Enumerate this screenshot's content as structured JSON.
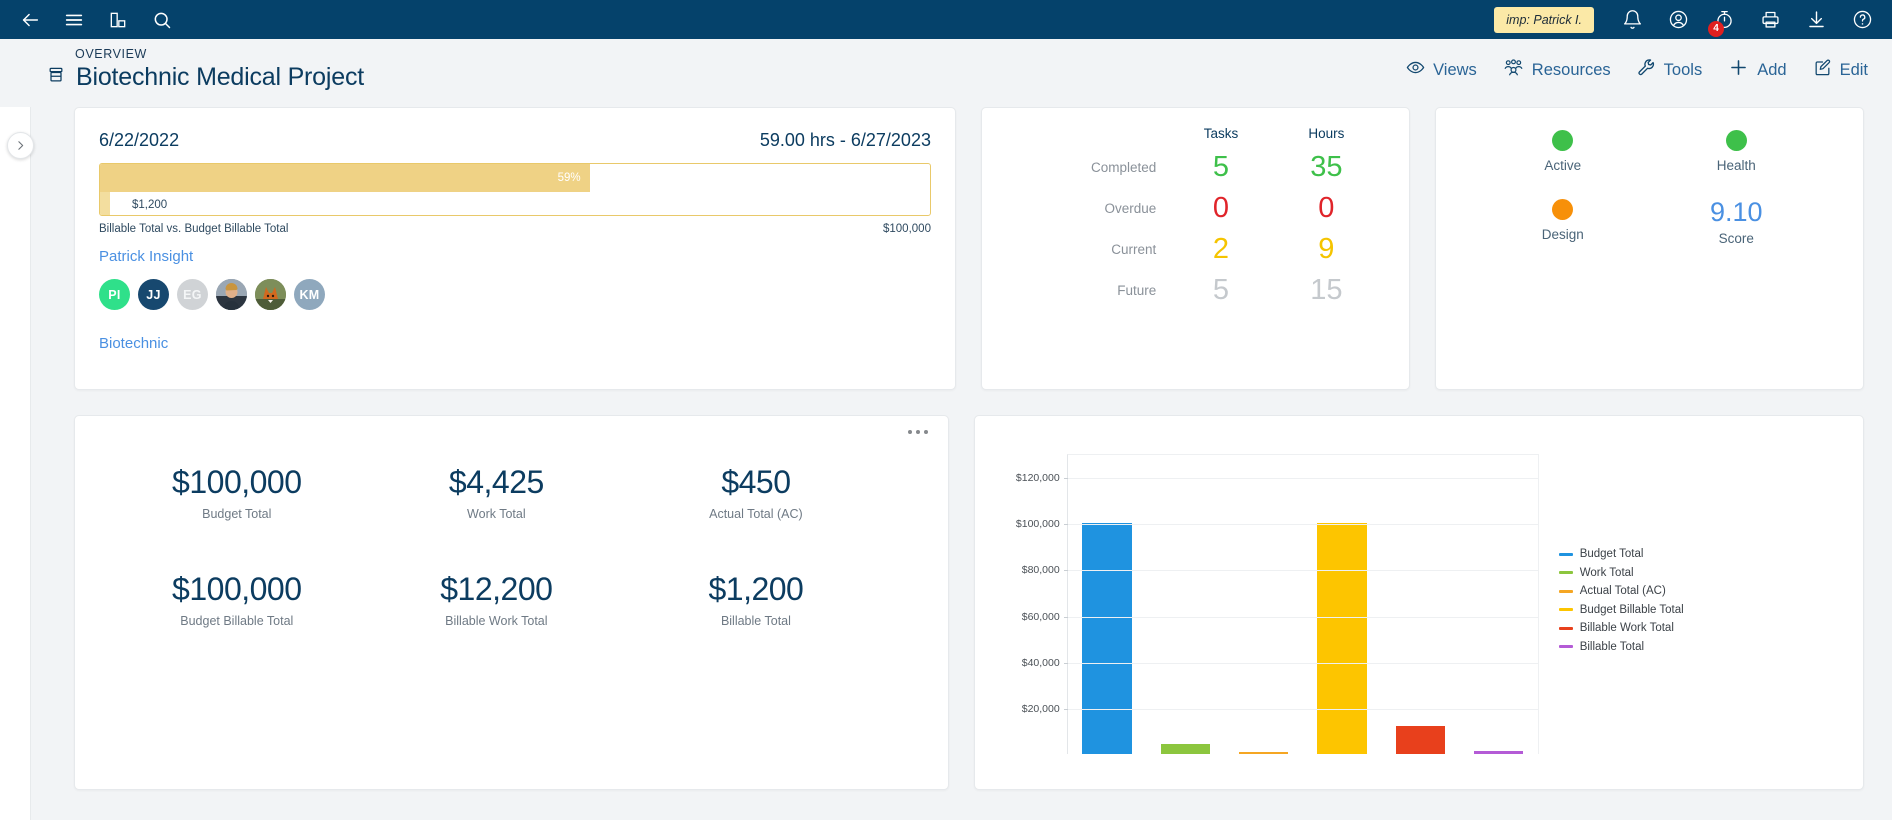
{
  "topnav": {
    "icons": [
      {
        "name": "back-arrow-icon",
        "label": "Back"
      },
      {
        "name": "hamburger-menu-icon",
        "label": "Menu"
      },
      {
        "name": "reports-icon",
        "label": "Reports"
      },
      {
        "name": "search-icon",
        "label": "Search"
      }
    ],
    "impersonation_badge": "imp: Patrick I.",
    "right_icons": [
      {
        "name": "bell-icon",
        "label": "Notifications"
      },
      {
        "name": "user-account-icon",
        "label": "Account"
      },
      {
        "name": "timer-icon",
        "label": "Timers",
        "badge": "4"
      },
      {
        "name": "printer-icon",
        "label": "Print"
      },
      {
        "name": "download-icon",
        "label": "Download"
      },
      {
        "name": "help-icon",
        "label": "Help"
      }
    ]
  },
  "header": {
    "breadcrumb": "OVERVIEW",
    "title": "Biotechnic Medical Project",
    "project_icon": "project-box-icon",
    "actions": [
      {
        "label": "Views",
        "icon": "eye-icon"
      },
      {
        "label": "Resources",
        "icon": "people-group-icon"
      },
      {
        "label": "Tools",
        "icon": "wrench-icon"
      },
      {
        "label": "Add",
        "icon": "plus-icon"
      },
      {
        "label": "Edit",
        "icon": "pencil-square-icon"
      }
    ]
  },
  "sidebar": {
    "expand_toggle_icon": "chevron-right-icon"
  },
  "progress_card": {
    "start_date": "6/22/2022",
    "hours_and_end": "59.00 hrs - 6/27/2023",
    "top_bar_percent_label": "59%",
    "top_bar_percent": 59,
    "bottom_bar_value_label": "$1,200",
    "bottom_bar_percent": 1.2,
    "legend_left": "Billable Total vs. Budget Billable Total",
    "legend_right": "$100,000",
    "insight_link": "Patrick Insight",
    "company_link": "Biotechnic",
    "avatars": [
      {
        "initials": "PI",
        "color": "#2fe08a",
        "type": "initials"
      },
      {
        "initials": "JJ",
        "color": "#17486f",
        "type": "initials"
      },
      {
        "initials": "EG",
        "color": "#d0d3d6",
        "type": "initials"
      },
      {
        "initials": "",
        "color": "#7d8a97",
        "type": "photo-person"
      },
      {
        "initials": "",
        "color": "#6f7f52",
        "type": "photo-fox"
      },
      {
        "initials": "KM",
        "color": "#8fa8bd",
        "type": "initials"
      }
    ]
  },
  "matrix_card": {
    "columns": [
      "Tasks",
      "Hours"
    ],
    "rows": [
      {
        "label": "Completed",
        "tasks": "5",
        "hours": "35",
        "color_class": "g"
      },
      {
        "label": "Overdue",
        "tasks": "0",
        "hours": "0",
        "color_class": "r"
      },
      {
        "label": "Current",
        "tasks": "2",
        "hours": "9",
        "color_class": "y"
      },
      {
        "label": "Future",
        "tasks": "5",
        "hours": "15",
        "color_class": "gr"
      }
    ]
  },
  "status_card": {
    "items": [
      {
        "label": "Active",
        "dot_color": "#3ec04a",
        "kind": "dot"
      },
      {
        "label": "Health",
        "dot_color": "#3ec04a",
        "kind": "dot"
      },
      {
        "label": "Design",
        "dot_color": "#f79009",
        "kind": "dot"
      },
      {
        "label": "Score",
        "value": "9.10",
        "kind": "value"
      }
    ]
  },
  "kpi_card": {
    "menu_icon": "ellipsis-icon",
    "items": [
      {
        "value": "$100,000",
        "caption": "Budget Total"
      },
      {
        "value": "$4,425",
        "caption": "Work Total"
      },
      {
        "value": "$450",
        "caption": "Actual Total (AC)"
      },
      {
        "value": "$100,000",
        "caption": "Budget Billable Total"
      },
      {
        "value": "$12,200",
        "caption": "Billable Work Total"
      },
      {
        "value": "$1,200",
        "caption": "Billable Total"
      }
    ]
  },
  "chart_data": {
    "type": "bar",
    "title": "",
    "xlabel": "",
    "ylabel": "",
    "ylim": [
      0,
      130000
    ],
    "grid": true,
    "legend_position": "right",
    "ticks": [
      "$120,000",
      "$100,000",
      "$80,000",
      "$60,000",
      "$40,000",
      "$20,000"
    ],
    "tick_values": [
      120000,
      100000,
      80000,
      60000,
      40000,
      20000
    ],
    "categories": [
      "Budget Total",
      "Work Total",
      "Actual Total (AC)",
      "Budget Billable Total",
      "Billable Work Total",
      "Billable Total"
    ],
    "values": [
      100000,
      4425,
      450,
      100000,
      12200,
      1200
    ],
    "colors": [
      "#1f93e0",
      "#8cc63e",
      "#f5a623",
      "#fdc500",
      "#e8401c",
      "#b45bd6"
    ],
    "series": [
      {
        "name": "Budget Total",
        "color": "#1f93e0",
        "value": 100000
      },
      {
        "name": "Work Total",
        "color": "#8cc63e",
        "value": 4425
      },
      {
        "name": "Actual Total (AC)",
        "color": "#f5a623",
        "value": 450
      },
      {
        "name": "Budget Billable Total",
        "color": "#fdc500",
        "value": 100000
      },
      {
        "name": "Billable Work Total",
        "color": "#e8401c",
        "value": 12200
      },
      {
        "name": "Billable Total",
        "color": "#b45bd6",
        "value": 1200
      }
    ]
  }
}
